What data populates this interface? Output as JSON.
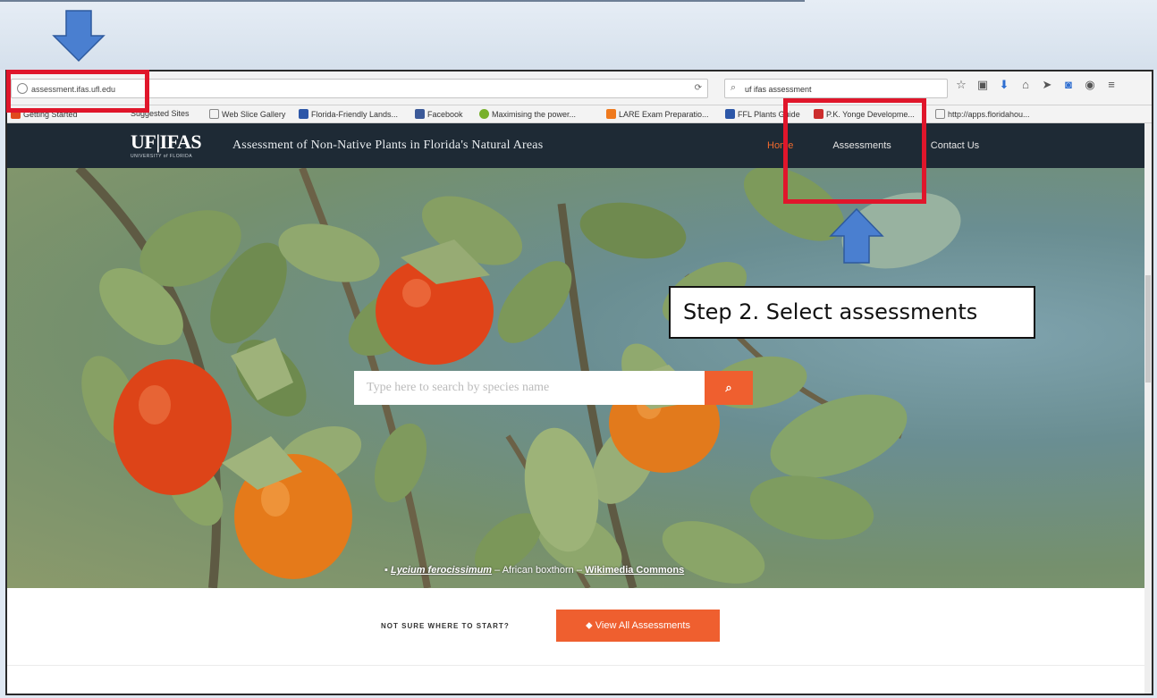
{
  "browser": {
    "url": "assessment.ifas.ufl.edu",
    "search_value": "uf ifas assessment"
  },
  "bookmarks": [
    {
      "label": "Getting Started",
      "color": "#e04a1d"
    },
    {
      "label": "Suggested Sites",
      "color": "#888888"
    },
    {
      "label": "Web Slice Gallery",
      "color": "#888888"
    },
    {
      "label": "Florida-Friendly Lands...",
      "color": "#2d57a8"
    },
    {
      "label": "Facebook",
      "color": "#3b5998"
    },
    {
      "label": "Maximising the power...",
      "color": "#77b02b"
    },
    {
      "label": "LARE Exam Preparatio...",
      "color": "#ef7a1e"
    },
    {
      "label": "FFL Plants Guide",
      "color": "#2d57a8"
    },
    {
      "label": "P.K. Yonge Developme...",
      "color": "#cc2d2d"
    },
    {
      "label": "http://apps.floridahou...",
      "color": "#888888"
    }
  ],
  "site": {
    "logo": "UF|IFAS",
    "logo_sub": "UNIVERSITY of FLORIDA",
    "title": "Assessment of Non-Native Plants in Florida's Natural Areas",
    "nav": {
      "home": "Home",
      "assessments": "Assessments",
      "contact": "Contact Us"
    }
  },
  "hero": {
    "search_placeholder": "Type here to search by species name",
    "caption_species": "Lycium ferocissimum",
    "caption_common": "African boxthorn",
    "caption_source": "Wikimedia Commons"
  },
  "cta": {
    "text": "NOT SURE WHERE TO START?",
    "button": "View All Assessments"
  },
  "annotation": {
    "callout": "Step 2. Select assessments"
  },
  "colors": {
    "accent": "#ef5f2f",
    "header": "#1e2a35",
    "annotation_red": "#e0162b",
    "arrow_blue": "#4a7fd0"
  }
}
